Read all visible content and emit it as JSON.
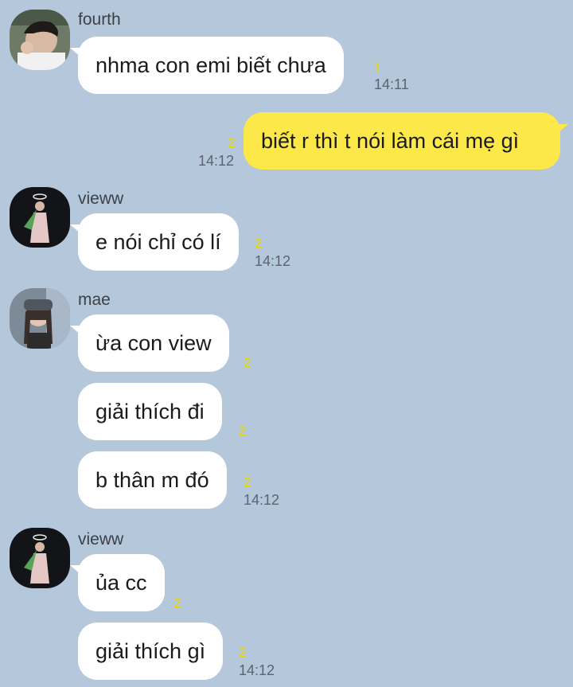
{
  "colors": {
    "background": "#b4c7db",
    "bubble_in": "#ffffff",
    "bubble_out": "#fde84a",
    "unread": "#e8d600",
    "time": "#5b6470"
  },
  "messages": [
    {
      "sender": "fourth",
      "avatar": "fourth-avatar",
      "text": "nhma con emi biết chưa",
      "unread": "1",
      "time": "14:11"
    },
    {
      "sender": "me",
      "text": "biết r thì t nói làm cái mẹ gì",
      "unread": "2",
      "time": "14:12"
    },
    {
      "sender": "vieww",
      "avatar": "vieww-avatar",
      "text": "e nói chỉ có lí",
      "unread": "2",
      "time": "14:12"
    },
    {
      "sender": "mae",
      "avatar": "mae-avatar",
      "texts": [
        "ừa con view",
        "giải thích đi",
        "b thân m đó"
      ],
      "unread": [
        "2",
        "2",
        "2"
      ],
      "time": "14:12"
    },
    {
      "sender": "vieww",
      "avatar": "vieww-avatar",
      "texts": [
        "ủa cc",
        "giải thích gì"
      ],
      "unread": [
        "2",
        "2"
      ],
      "time": "14:12"
    }
  ]
}
